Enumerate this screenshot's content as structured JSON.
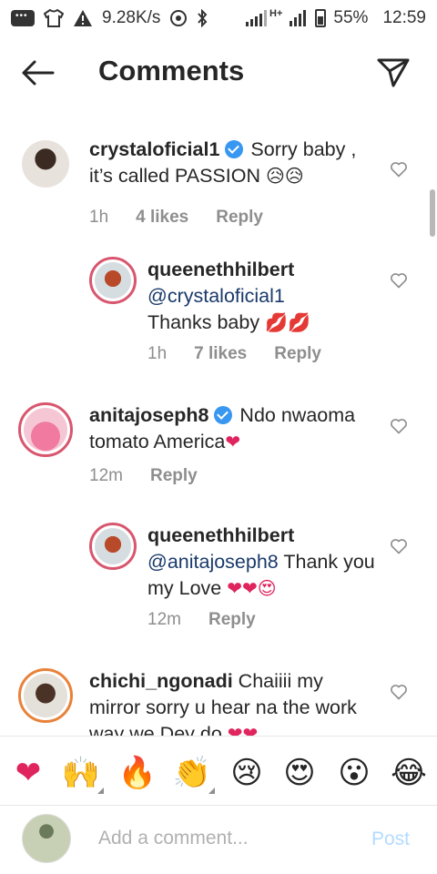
{
  "status_bar": {
    "speed": "9.28K/s",
    "network": "H+",
    "battery": "55%",
    "time": "12:59"
  },
  "header": {
    "title": "Comments"
  },
  "comments": [
    {
      "username": "crystaloficial1",
      "verified": true,
      "text": "Sorry baby , it’s called PASSION",
      "emojis": "😥😥",
      "time": "1h",
      "likes": "4 likes",
      "reply": "Reply"
    },
    {
      "username": "queenethhilbert",
      "verified": false,
      "mention": "@crystaloficial1",
      "text": "Thanks baby",
      "emojis": "💋💋",
      "time": "1h",
      "likes": "7 likes",
      "reply": "Reply"
    },
    {
      "username": "anitajoseph8",
      "verified": true,
      "text": "Ndo nwaoma tomato America",
      "emojis": "❤",
      "time": "12m",
      "reply": "Reply"
    },
    {
      "username": "queenethhilbert",
      "verified": false,
      "mention": "@anitajoseph8",
      "text": "Thank you my Love",
      "emojis": "❤❤😍",
      "time": "12m",
      "reply": "Reply"
    },
    {
      "username": "chichi_ngonadi",
      "verified": false,
      "text": "Chaiiii my mirror sorry u hear na the work way we Dey do",
      "emojis": "❤❤"
    }
  ],
  "emoji_bar": [
    "❤",
    "🙌",
    "🔥",
    "👏",
    "😢",
    "😍",
    "😮",
    "😂"
  ],
  "input": {
    "placeholder": "Add a comment...",
    "post_label": "Post"
  },
  "colors": {
    "verified": "#3897f0",
    "secondary_text": "#8e8e8e",
    "post_disabled": "#b3dbff"
  }
}
